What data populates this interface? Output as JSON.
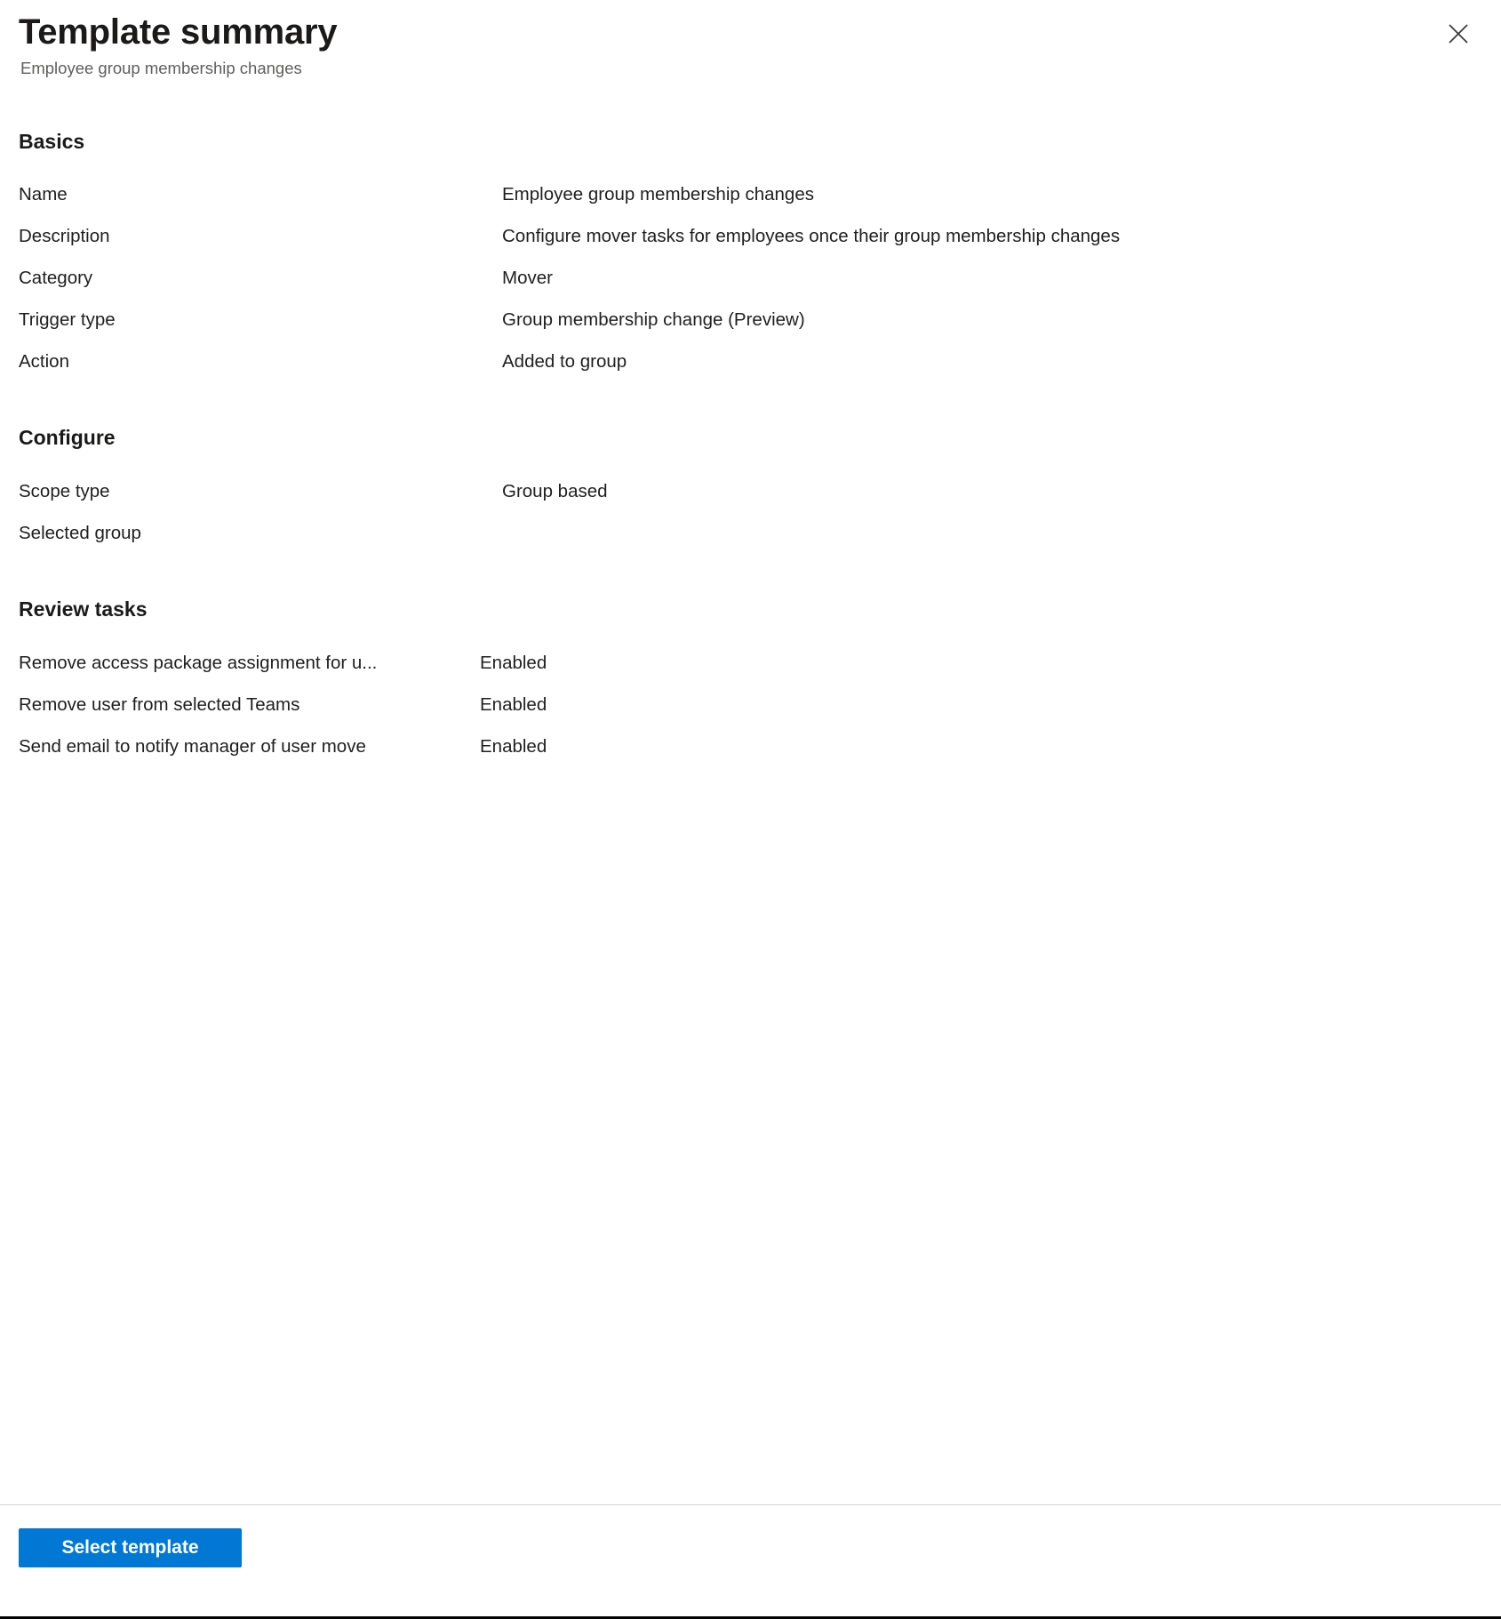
{
  "header": {
    "title": "Template summary",
    "subtitle": "Employee group membership changes",
    "close_icon": "close-icon"
  },
  "sections": {
    "basics": {
      "title": "Basics",
      "rows": [
        {
          "label": "Name",
          "value": "Employee group membership changes"
        },
        {
          "label": "Description",
          "value": "Configure mover tasks for employees once their group membership changes"
        },
        {
          "label": "Category",
          "value": "Mover"
        },
        {
          "label": "Trigger type",
          "value": "Group membership change (Preview)"
        },
        {
          "label": "Action",
          "value": "Added to group"
        }
      ]
    },
    "configure": {
      "title": "Configure",
      "rows": [
        {
          "label": "Scope type",
          "value": "Group based"
        },
        {
          "label": "Selected group",
          "value": ""
        }
      ]
    },
    "review_tasks": {
      "title": "Review tasks",
      "rows": [
        {
          "label": "Remove access package assignment for u...",
          "value": "Enabled"
        },
        {
          "label": "Remove user from selected Teams",
          "value": "Enabled"
        },
        {
          "label": "Send email to notify manager of user move",
          "value": "Enabled"
        }
      ]
    }
  },
  "footer": {
    "primary_button_label": "Select template"
  },
  "colors": {
    "accent": "#0078d4",
    "text_primary": "#201f1e",
    "text_secondary": "#605e5c",
    "divider": "#d6d6d6"
  }
}
